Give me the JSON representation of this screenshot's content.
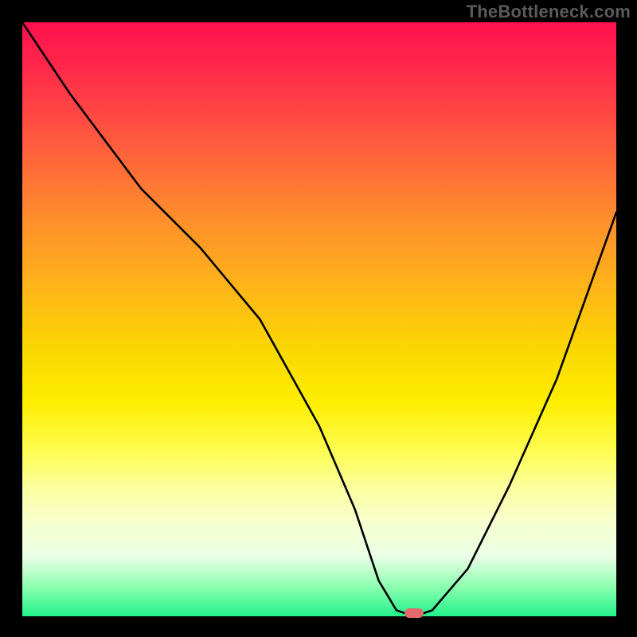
{
  "watermark": "TheBottleneck.com",
  "chart_data": {
    "type": "line",
    "title": "",
    "xlabel": "",
    "ylabel": "",
    "xlim": [
      0,
      100
    ],
    "ylim": [
      0,
      100
    ],
    "grid": false,
    "series": [
      {
        "name": "bottleneck-curve",
        "x": [
          0,
          8,
          20,
          30,
          40,
          50,
          56,
          60,
          63,
          66,
          69,
          75,
          82,
          90,
          100
        ],
        "values": [
          100,
          88,
          72,
          62,
          50,
          32,
          18,
          6,
          1,
          0,
          1,
          8,
          22,
          40,
          68
        ]
      }
    ],
    "marker": {
      "x": 66,
      "y": 0,
      "color": "#e26a6a"
    },
    "gradient_stops": [
      {
        "pct": 0,
        "color": "#ff104f"
      },
      {
        "pct": 50,
        "color": "#fada00"
      },
      {
        "pct": 95,
        "color": "#8dffb0"
      },
      {
        "pct": 100,
        "color": "#23f18a"
      }
    ]
  }
}
